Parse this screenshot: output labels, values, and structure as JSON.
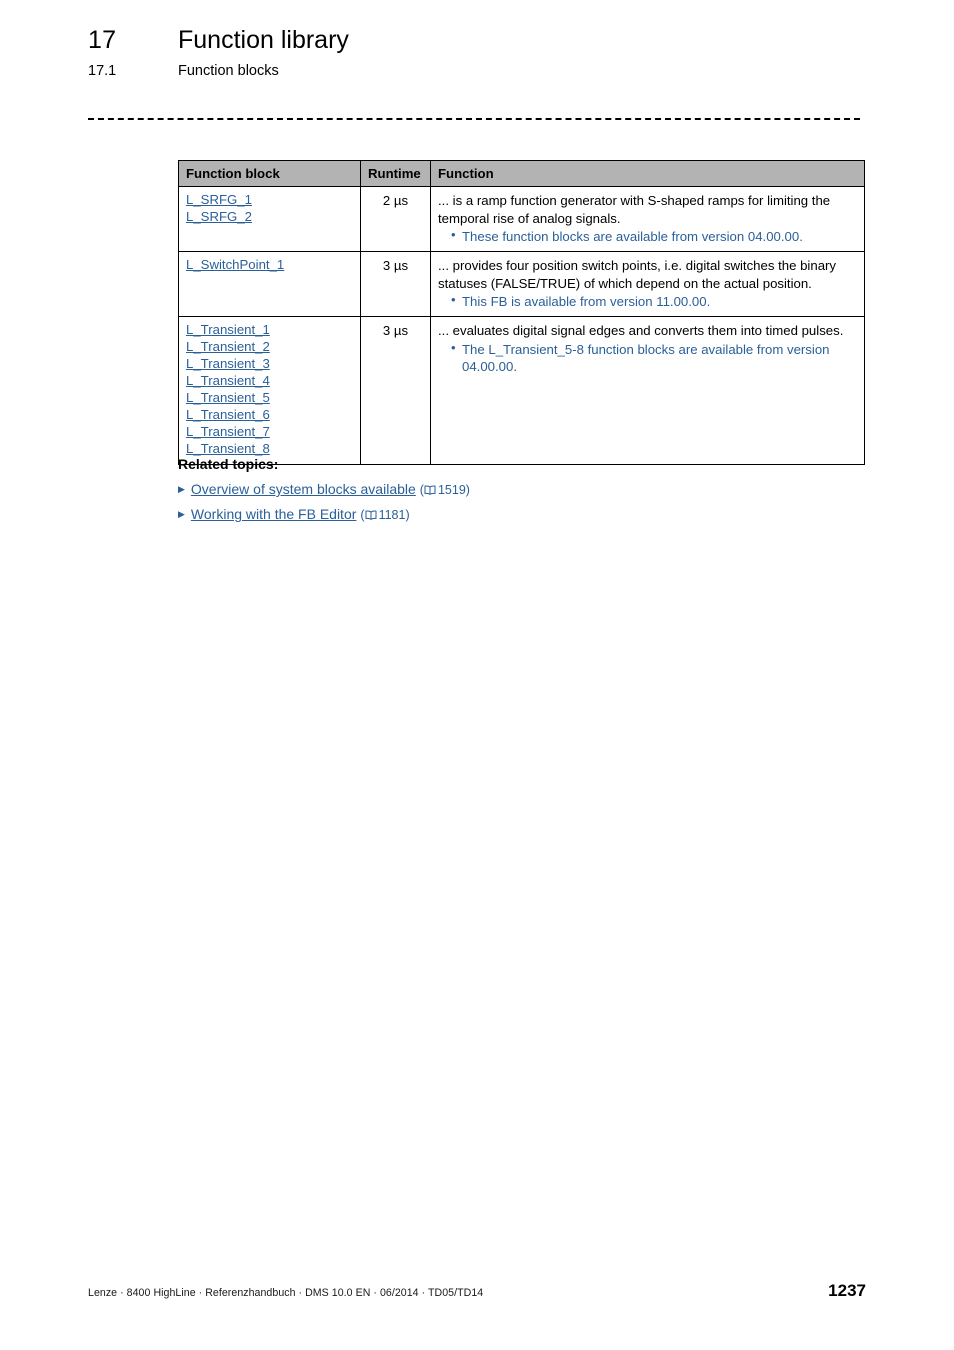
{
  "header": {
    "chapter_number": "17",
    "chapter_title": "Function library",
    "section_number": "17.1",
    "section_title": "Function blocks"
  },
  "table": {
    "columns": [
      "Function block",
      "Runtime",
      "Function"
    ],
    "rows": [
      {
        "blocks": [
          "L_SRFG_1",
          "L_SRFG_2"
        ],
        "runtime": "2 µs",
        "description": "... is a ramp function generator with S-shaped ramps for limiting the temporal rise of analog signals.",
        "notes": [
          "These function blocks are available from version 04.00.00."
        ]
      },
      {
        "blocks": [
          "L_SwitchPoint_1"
        ],
        "runtime": "3 µs",
        "description": "... provides four position switch points, i.e. digital switches the binary statuses (FALSE/TRUE) of which depend on the actual position.",
        "notes": [
          "This FB is available from version 11.00.00."
        ]
      },
      {
        "blocks": [
          "L_Transient_1",
          "L_Transient_2",
          "L_Transient_3",
          "L_Transient_4",
          "L_Transient_5",
          "L_Transient_6",
          "L_Transient_7",
          "L_Transient_8"
        ],
        "runtime": "3 µs",
        "description": "... evaluates digital signal edges and converts them into timed pulses.",
        "notes": [
          "The L_Transient_5-8 function blocks are available from version 04.00.00."
        ]
      }
    ]
  },
  "related": {
    "title": "Related topics:",
    "items": [
      {
        "label": "Overview of system blocks available",
        "page": "1519"
      },
      {
        "label": "Working with the FB Editor",
        "page": "1181"
      }
    ]
  },
  "footer": {
    "text": "Lenze · 8400 HighLine · Referenzhandbuch · DMS 10.0 EN · 06/2014 · TD05/TD14",
    "page_number": "1237"
  },
  "colors": {
    "link": "#2a6099",
    "table_header_bg": "#b3b3b3",
    "border": "#000000"
  }
}
